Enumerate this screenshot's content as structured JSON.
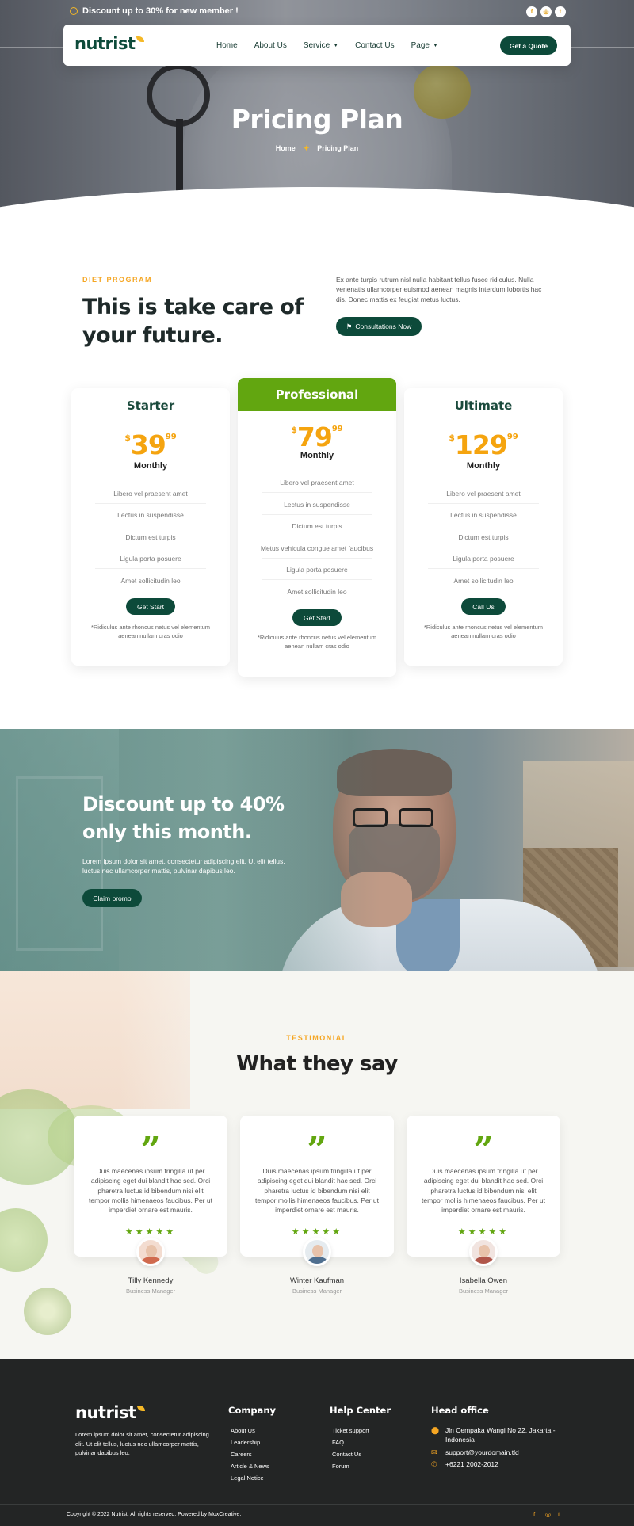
{
  "topbar": {
    "promo_text": "Discount up to 30% for new member !",
    "social_icons": [
      "facebook-icon",
      "instagram-icon",
      "twitter-icon"
    ],
    "social_glyphs": [
      "f",
      "◎",
      "t"
    ]
  },
  "nav": {
    "logo": "nutrist",
    "items": [
      {
        "label": "Home",
        "dropdown": false
      },
      {
        "label": "About Us",
        "dropdown": false
      },
      {
        "label": "Service",
        "dropdown": true
      },
      {
        "label": "Contact Us",
        "dropdown": false
      },
      {
        "label": "Page",
        "dropdown": true
      }
    ],
    "cta_label": "Get a Quote"
  },
  "hero": {
    "title": "Pricing Plan",
    "breadcrumb": [
      "Home",
      "Pricing Plan"
    ]
  },
  "intro": {
    "eyebrow": "DIET PROGRAM",
    "title": "This is take care of your future.",
    "text": "Ex ante turpis rutrum nisl nulla habitant tellus fusce ridiculus. Nulla venenatis ullamcorper euismod aenean magnis interdum lobortis hac dis. Donec mattis ex feugiat metus luctus.",
    "button_label": "Consultations Now"
  },
  "pricing": {
    "plans": [
      {
        "name": "Starter",
        "currency": "$",
        "amount": "39",
        "cents": "99",
        "period": "Monthly",
        "features": [
          "Libero vel praesent amet",
          "Lectus in suspendisse",
          "Dictum est turpis",
          "Ligula porta posuere",
          "Amet sollicitudin leo"
        ],
        "button": "Get Start",
        "note": "*Ridiculus ante rhoncus netus vel elementum aenean nullam cras odio"
      },
      {
        "name": "Professional",
        "currency": "$",
        "amount": "79",
        "cents": "99",
        "period": "Monthly",
        "features": [
          "Libero vel praesent amet",
          "Lectus in suspendisse",
          "Dictum est turpis",
          "Metus vehicula congue amet faucibus",
          "Ligula porta posuere",
          "Amet sollicitudin leo"
        ],
        "button": "Get Start",
        "note": "*Ridiculus ante rhoncus netus vel elementum aenean nullam cras odio",
        "featured": true
      },
      {
        "name": "Ultimate",
        "currency": "$",
        "amount": "129",
        "cents": "99",
        "period": "Monthly",
        "features": [
          "Libero vel praesent amet",
          "Lectus in suspendisse",
          "Dictum est turpis",
          "Ligula porta posuere",
          "Amet sollicitudin leo"
        ],
        "button": "Call Us",
        "note": "*Ridiculus ante rhoncus netus vel elementum aenean nullam cras odio"
      }
    ]
  },
  "banner": {
    "title": "Discount up to 40% only this month.",
    "text": "Lorem ipsum dolor sit amet, consectetur adipiscing elit. Ut elit tellus, luctus nec ullamcorper mattis, pulvinar dapibus leo.",
    "button_label": "Claim promo"
  },
  "testimonials": {
    "eyebrow": "TESTIMONIAL",
    "title": "What they say",
    "items": [
      {
        "quote": "Duis maecenas ipsum fringilla ut per adipiscing eget dui blandit hac sed. Orci pharetra luctus id bibendum nisi elit tempor mollis himenaeos faucibus. Per ut imperdiet ornare est mauris.",
        "stars": "★★★★★",
        "rating": 5,
        "name": "Tilly Kennedy",
        "role": "Business Manager"
      },
      {
        "quote": "Duis maecenas ipsum fringilla ut per adipiscing eget dui blandit hac sed. Orci pharetra luctus id bibendum nisi elit tempor mollis himenaeos faucibus. Per ut imperdiet ornare est mauris.",
        "stars": "★★★★★",
        "rating": 5,
        "name": "Winter Kaufman",
        "role": "Business Manager"
      },
      {
        "quote": "Duis maecenas ipsum fringilla ut per adipiscing eget dui blandit hac sed. Orci pharetra luctus id bibendum nisi elit tempor mollis himenaeos faucibus. Per ut imperdiet ornare est mauris.",
        "stars": "★★★★★",
        "rating": 5,
        "name": "Isabella Owen",
        "role": "Business Manager"
      }
    ]
  },
  "footer": {
    "logo": "nutrist",
    "about": "Lorem ipsum dolor sit amet, consectetur adipiscing elit. Ut elit tellus, luctus nec ullamcorper mattis, pulvinar dapibus leo.",
    "company": {
      "heading": "Company",
      "links": [
        "About Us",
        "Leadership",
        "Careers",
        "Article & News",
        "Legal Notice"
      ]
    },
    "help": {
      "heading": "Help Center",
      "links": [
        "Ticket support",
        "FAQ",
        "Contact Us",
        "Forum"
      ]
    },
    "office": {
      "heading": "Head office",
      "address": "Jln Cempaka Wangi No 22, Jakarta - Indonesia",
      "email": "support@yourdomain.tld",
      "phone": "+6221 2002-2012"
    },
    "copyright": "Copyright © 2022 Nutrist, All rights reserved. Powered by MoxCreative.",
    "social_icons": [
      "facebook-icon",
      "instagram-icon",
      "twitter-icon"
    ]
  },
  "colors": {
    "brand_dark_green": "#0d4a3a",
    "accent_green": "#62a610",
    "accent_orange": "#f5a623",
    "footer_bg": "#232525"
  }
}
